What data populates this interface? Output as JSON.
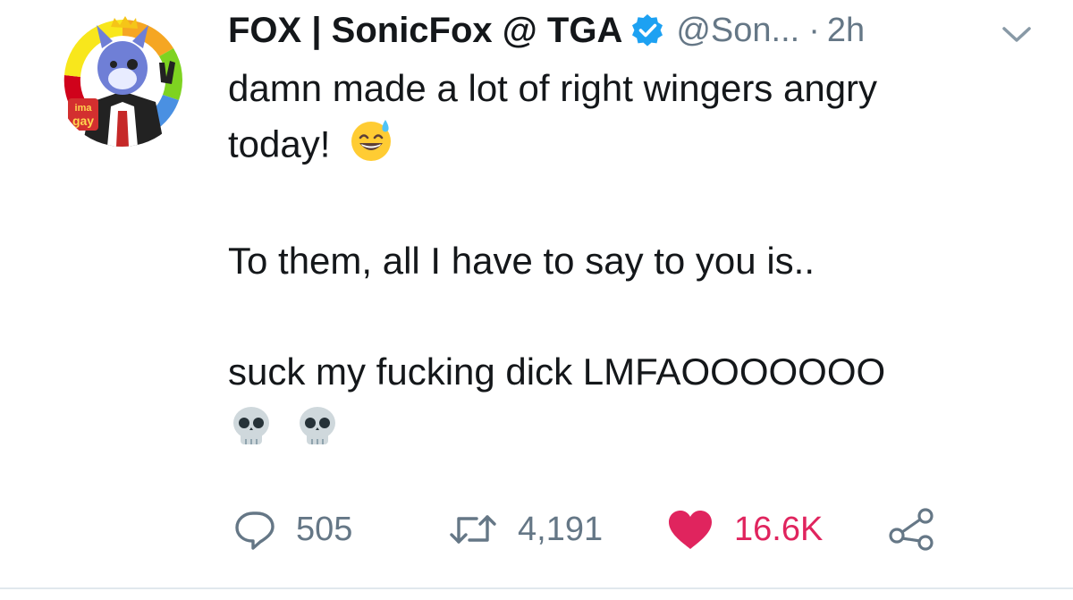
{
  "tweet": {
    "author": {
      "display_name": "FOX | SonicFox @ TGA",
      "handle": "@Son...",
      "verified": true,
      "avatar_badge_text": "ima gay"
    },
    "separator": "·",
    "timestamp": "2h",
    "text_lines": [
      "damn made a lot of right wingers angry",
      "today!",
      "",
      "To them, all I have to say to you is..",
      "",
      "suck my fucking dick LMFAOOOOOOO"
    ],
    "emojis": [
      "grinning-sweat-emoji",
      "skull-emoji",
      "skull-emoji"
    ],
    "stats": {
      "replies": "505",
      "retweets": "4,191",
      "likes": "16.6K"
    }
  },
  "icons": {
    "verified": "verified-badge-icon",
    "chevron": "chevron-down-icon",
    "reply": "reply-bubble-icon",
    "retweet": "retweet-icon",
    "like": "heart-icon",
    "share": "share-icon"
  },
  "colors": {
    "text": "#14171a",
    "secondary": "#657786",
    "verified": "#1da1f2",
    "like": "#e0245e",
    "divider": "#e1e8ed"
  }
}
